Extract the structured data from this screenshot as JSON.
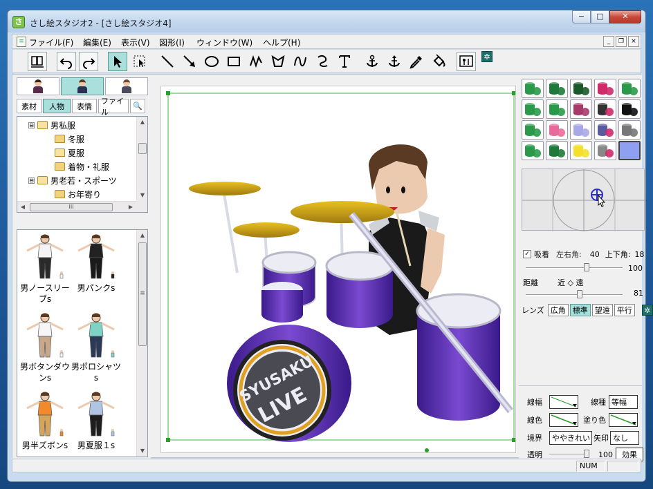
{
  "window": {
    "title": "さし絵スタジオ2 - [さし絵スタジオ4]",
    "app_icon_glyph": "さ",
    "minimize_icon": "−",
    "maximize_icon": "□",
    "close_icon": "✕"
  },
  "menu": {
    "items": [
      "ファイル(F)",
      "編集(E)",
      "表示(V)",
      "図形(I)",
      "ウィンドウ(W)",
      "ヘルプ(H)"
    ],
    "mdi_minimize": "_",
    "mdi_restore": "❐",
    "mdi_close": "×"
  },
  "toolbar": {
    "gear_glyph": "✲"
  },
  "left_panel": {
    "search_icon": "🔍",
    "tabs": [
      "素材",
      "人物",
      "表情",
      "ファイル"
    ],
    "tree": [
      {
        "label": "男私服",
        "expander": "⊟"
      },
      {
        "label": "冬服",
        "expander": ""
      },
      {
        "label": "夏服",
        "expander": ""
      },
      {
        "label": "着物・礼服",
        "expander": ""
      },
      {
        "label": "男老若・スポーツ",
        "expander": "⊟"
      },
      {
        "label": "お年寄り",
        "expander": ""
      }
    ],
    "hscroll_grip": "III",
    "vscroll_up": "▲",
    "vscroll_down": "▼",
    "vscroll_grip": "≡",
    "gallery": [
      {
        "label": "男ノースリーブs",
        "shirt": "#f4f4f4",
        "pants": "#2a2a2a"
      },
      {
        "label": "男パンクs",
        "shirt": "#222222",
        "pants": "#1a1a1a"
      },
      {
        "label": "男ボタンダウンs",
        "shirt": "#f6f6f6",
        "pants": "#c8a88a"
      },
      {
        "label": "男ポロシャツs",
        "shirt": "#7fd3c4",
        "pants": "#2c3a58"
      },
      {
        "label": "男半ズボンs",
        "shirt": "#f08a2a",
        "pants": "#d4a55a"
      },
      {
        "label": "男夏服１s",
        "shirt": "#b0c4e4",
        "pants": "#1e1e1e"
      }
    ]
  },
  "canvas": {
    "drum_text_1": "SYUSAKU",
    "drum_text_2": "LIVE"
  },
  "right_panel": {
    "camera": {
      "snap_label": "吸着",
      "snap_checked": "✓",
      "lr_angle_label": "左右角:",
      "lr_angle_value": "40",
      "ud_angle_label": "上下角:",
      "ud_angle_value": "18",
      "slider1_value": "100",
      "distance_label": "距離",
      "distance_range": "近 ◇ 遠",
      "slider2_value": "81",
      "lens_label": "レンズ",
      "lens_options": [
        "広角",
        "標準",
        "望遠",
        "平行"
      ],
      "lens_selected": "標準",
      "gear_glyph": "✲"
    },
    "properties": {
      "line_width_label": "線幅",
      "line_type_label": "線種",
      "line_type_value": "等幅",
      "line_color_label": "線色",
      "fill_color_label": "塗り色",
      "border_label": "境界",
      "border_value": "ややきれい",
      "arrow_label": "矢印",
      "arrow_value": "なし",
      "opacity_label": "透明",
      "opacity_value": "100",
      "effect_label": "効果"
    }
  },
  "status": {
    "num_label": "NUM"
  }
}
